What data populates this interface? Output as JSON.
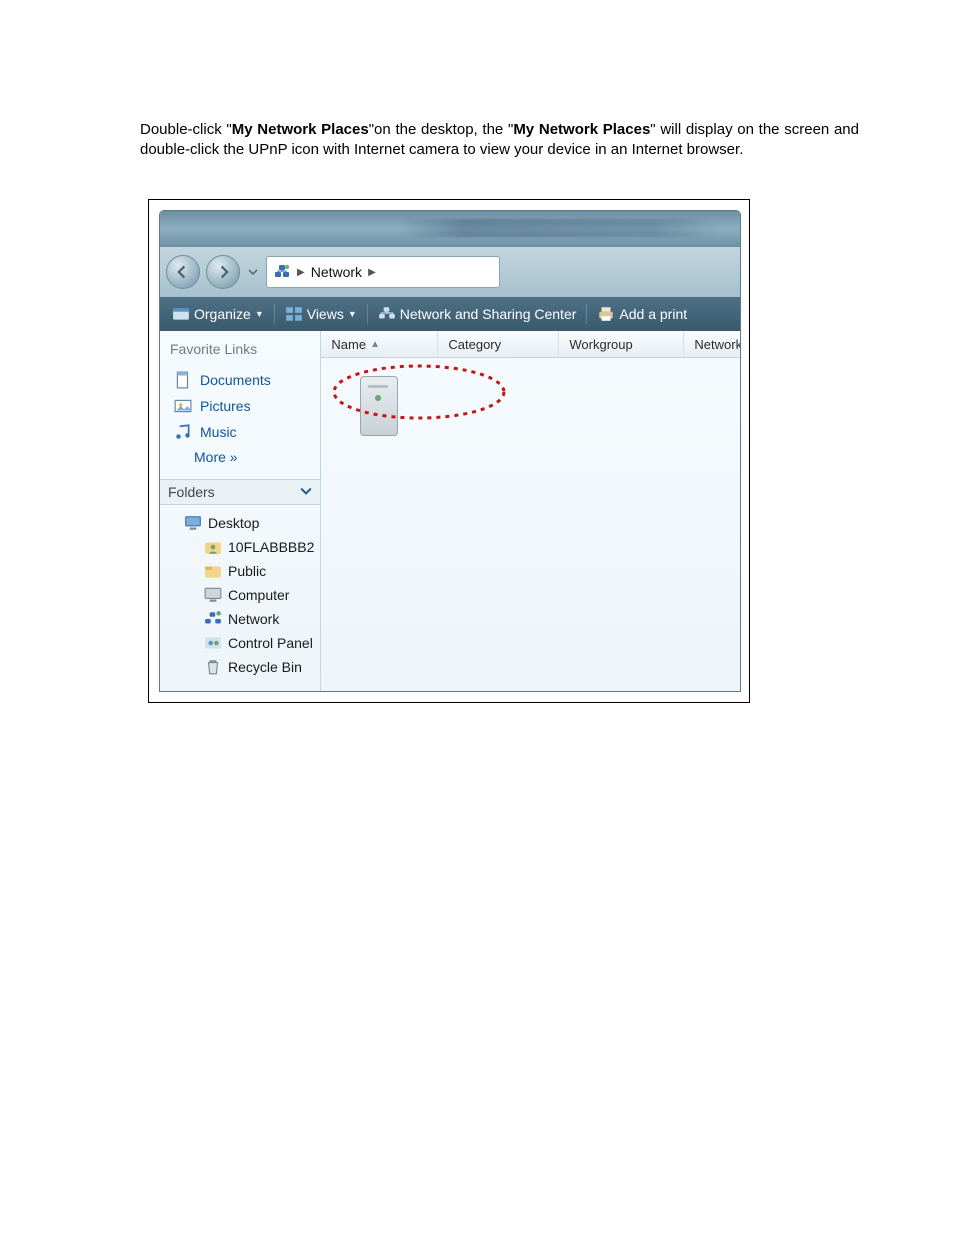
{
  "intro": {
    "pre": "Double-click \"",
    "bold1": "My Network Places",
    "mid1": "\"on the desktop, the \"",
    "bold2": "My Network Places",
    "mid2": "\" will display on the screen and double-click the UPnP icon with Internet camera to view your device in an Internet browser."
  },
  "addressbar": {
    "location": "Network"
  },
  "toolbar": {
    "organize": "Organize",
    "views": "Views",
    "nsc": "Network and Sharing Center",
    "addprinter": "Add a print"
  },
  "columns": {
    "name": "Name",
    "category": "Category",
    "workgroup": "Workgroup",
    "network": "Network"
  },
  "sidebar": {
    "fav_header": "Favorite Links",
    "fav_items": [
      "Documents",
      "Pictures",
      "Music",
      "More  »"
    ],
    "folders_header": "Folders",
    "tree": {
      "root": "Desktop",
      "children": [
        "10FLABBBB2",
        "Public",
        "Computer",
        "Network",
        "Control Panel",
        "Recycle Bin"
      ]
    }
  }
}
